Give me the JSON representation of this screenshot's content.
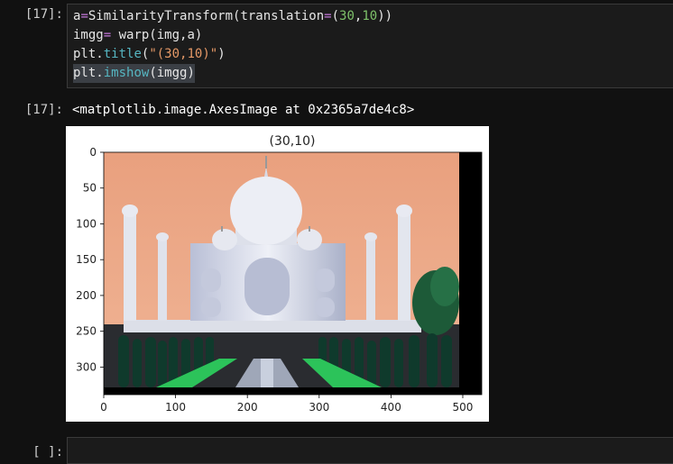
{
  "cell_in": {
    "prompt": "[17]:",
    "lines": [
      [
        {
          "t": "a",
          "c": "default"
        },
        {
          "t": "=",
          "c": "op"
        },
        {
          "t": "SimilarityTransform(translation",
          "c": "default"
        },
        {
          "t": "=",
          "c": "op"
        },
        {
          "t": "(",
          "c": "default"
        },
        {
          "t": "30",
          "c": "num"
        },
        {
          "t": ",",
          "c": "default"
        },
        {
          "t": "10",
          "c": "num"
        },
        {
          "t": "))",
          "c": "default"
        }
      ],
      [
        {
          "t": "imgg",
          "c": "default"
        },
        {
          "t": "=",
          "c": "op"
        },
        {
          "t": " warp(img,a)",
          "c": "default"
        }
      ],
      [
        {
          "t": "plt",
          "c": "default"
        },
        {
          "t": ".",
          "c": "default"
        },
        {
          "t": "title",
          "c": "fn"
        },
        {
          "t": "(",
          "c": "default"
        },
        {
          "t": "\"(30,10)\"",
          "c": "str"
        },
        {
          "t": ")",
          "c": "default"
        }
      ],
      [
        {
          "t": "plt",
          "c": "default"
        },
        {
          "t": ".",
          "c": "default"
        },
        {
          "t": "imshow",
          "c": "fn"
        },
        {
          "t": "(imgg)",
          "c": "default"
        }
      ]
    ]
  },
  "cell_out": {
    "prompt": "[17]:",
    "text": "<matplotlib.image.AxesImage at 0x2365a7de4c8>"
  },
  "plot": {
    "title": "(30,10)",
    "x_ticks": [
      "0",
      "100",
      "200",
      "300",
      "400",
      "500"
    ],
    "y_ticks": [
      "0",
      "50",
      "100",
      "150",
      "200",
      "250",
      "300"
    ]
  },
  "next_cell": {
    "prompt": "[ ]:"
  },
  "colors": {
    "op": "#c678dd",
    "num": "#7ec16a",
    "str": "#e59866",
    "fn": "#56b6c2",
    "default": "#e6e6e6"
  }
}
